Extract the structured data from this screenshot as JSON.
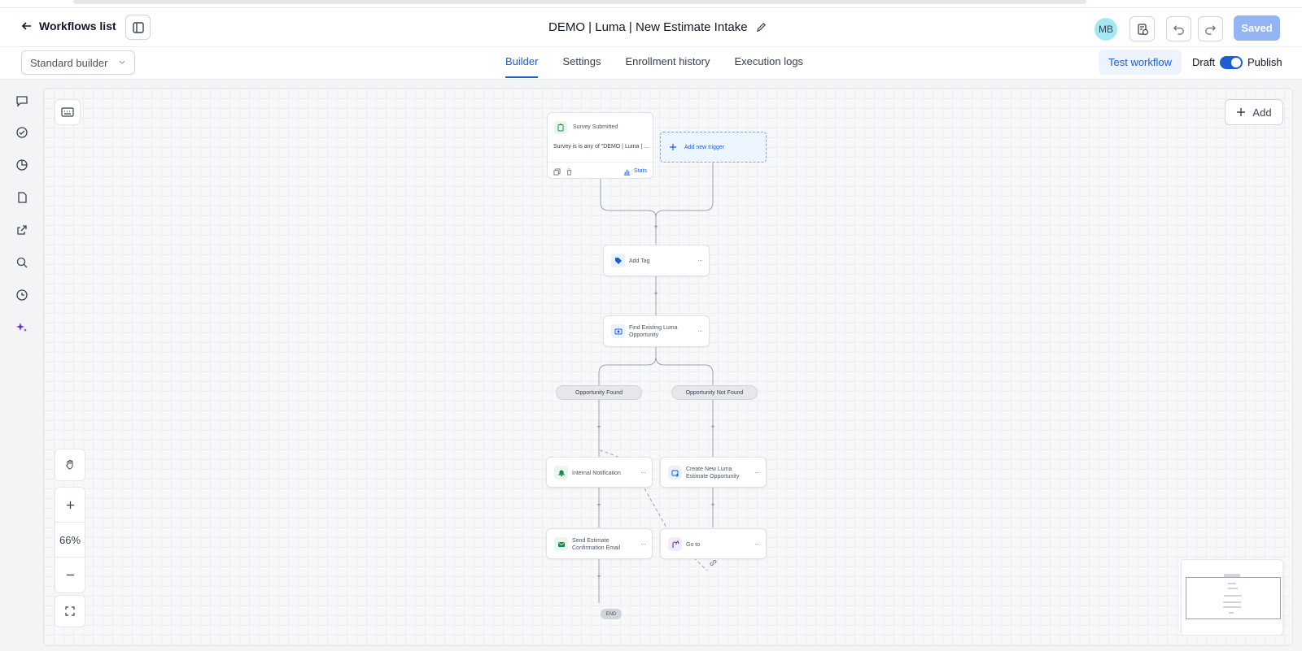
{
  "header": {
    "back_label": "Workflows list",
    "title": "DEMO | Luma | New Estimate Intake",
    "avatar_initials": "MB",
    "saved_label": "Saved"
  },
  "subbar": {
    "builder_select": "Standard builder",
    "tabs": [
      {
        "label": "Builder",
        "active": true
      },
      {
        "label": "Settings",
        "active": false
      },
      {
        "label": "Enrollment history",
        "active": false
      },
      {
        "label": "Execution logs",
        "active": false
      }
    ],
    "test_label": "Test workflow",
    "draft_label": "Draft",
    "publish_label": "Publish",
    "publish_on": true
  },
  "rail_icons": [
    "chat-icon",
    "check-circle-icon",
    "pie-chart-icon",
    "document-icon",
    "external-link-icon",
    "search-icon",
    "history-icon",
    "sparkle-icon"
  ],
  "canvas": {
    "add_label": "Add",
    "zoom_level": "66%",
    "trigger": {
      "title": "Survey Submitted",
      "condition": "Survey is is any of \"DEMO | Luma | ...",
      "stats_label": "Stats"
    },
    "add_trigger_label": "Add new trigger",
    "nodes": {
      "add_tag": "Add Tag",
      "find_opportunity": "Find Existing Luma Opportunity",
      "internal_notification": "Internal Notification",
      "create_opportunity": "Create New Luma Estimate Opportunity",
      "send_email": "Send Estimate Confirmation Email",
      "go_to": "Go to"
    },
    "branches": {
      "found": "Opportunity Found",
      "not_found": "Opportunity Not Found"
    },
    "end_label": "END"
  },
  "colors": {
    "accent": "#1d5fd0",
    "saved_bg": "#93b4f5",
    "avatar_bg": "#a5e8f2",
    "green_icon": "#0f8a4f",
    "blue_icon": "#1d5fd0",
    "purple_icon": "#6d28d9"
  }
}
